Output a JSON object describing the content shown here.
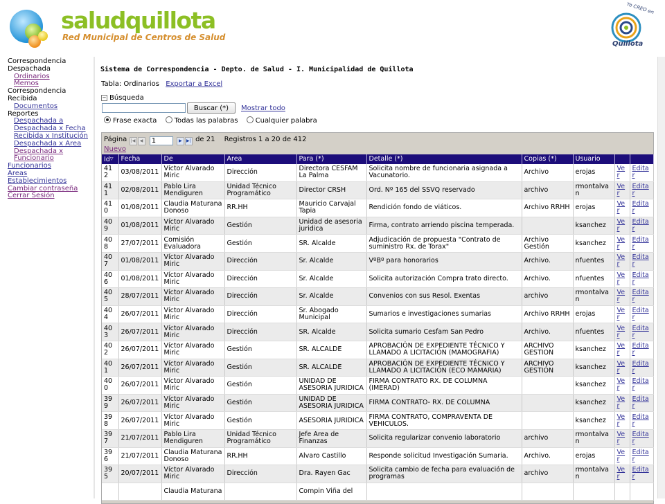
{
  "header": {
    "brand_name": "saludquillota",
    "brand_tagline": "Red Municipal de Centros de Salud",
    "seal_top": "Yo CREO en",
    "seal_word": "Quillota"
  },
  "sidebar": {
    "g1": "Correspondencia",
    "g1b": "Despachada",
    "ordinarios": "Ordinarios",
    "memos": "Memos",
    "g2": "Correspondencia",
    "g2b": "Recibida",
    "documentos": "Documentos",
    "g3": "Reportes",
    "r1a": "Despachada a",
    "r1b": "Despachada x Fecha",
    "r2": "Recibida x Institución",
    "r3": "Despachada x Area",
    "r4a": "Despachada x",
    "r4b": "Funcionario",
    "funcionarios": "Funcionarios",
    "areas": "Areas",
    "establecimientos": "Establecimientos",
    "cambiar": "Cambiar contraseña",
    "cerrar": "Cerrar Sesión"
  },
  "main": {
    "title": "Sistema de Correspondencia - Depto. de Salud - I. Municipalidad de Quillota",
    "tabla_label": "Tabla: Ordinarios",
    "exportar": "Exportar a Excel",
    "busqueda_label": "Búsqueda",
    "search_value": "",
    "buscar": "Buscar (*)",
    "mostrar_todo": "Mostrar todo",
    "radio_exacta": "Frase exacta",
    "radio_todas": "Todas las palabras",
    "radio_cualquier": "Cualquier palabra"
  },
  "pager": {
    "pagina": "Página",
    "page_value": "1",
    "de": "de 21",
    "registros": "Registros 1 a 20 de 412",
    "nuevo": "Nuevo"
  },
  "grid": {
    "columns": [
      "Id",
      "Fecha",
      "De",
      "Area",
      "Para (*)",
      "Detalle (*)",
      "Copias (*)",
      "Usuario",
      "",
      ""
    ],
    "ver": "Ver",
    "editar": "Editar",
    "rows": [
      [
        "412",
        "03/08/2011",
        "Víctor Alvarado Miric",
        "Dirección",
        "Directora CESFAM La Palma",
        "Solicita nombre de funcionaria asignada a Vacunatorio.",
        "Archivo",
        "erojas"
      ],
      [
        "411",
        "02/08/2011",
        "Pablo Lira Mendiguren",
        "Unidad Técnico Programático",
        "Director CRSH",
        "Ord. Nº 165 del SSVQ reservado",
        "archivo",
        "rmontalvan"
      ],
      [
        "410",
        "01/08/2011",
        "Claudia Maturana Donoso",
        "RR.HH",
        "Mauricio Carvajal Tapia",
        "Rendición fondo de viáticos.",
        "Archivo RRHH",
        "erojas"
      ],
      [
        "409",
        "01/08/2011",
        "Víctor Alvarado Miric",
        "Gestión",
        "Unidad de asesoria juridica",
        "Firma, contrato arriendo piscina temperada.",
        "",
        "ksanchez"
      ],
      [
        "408",
        "27/07/2011",
        "Comisión Evaluadora",
        "Gestión",
        "SR. Alcalde",
        "Adjudicación de propuesta \"Contrato de suministro Rx. de Torax\"",
        "Archivo Gestión",
        "ksanchez"
      ],
      [
        "407",
        "01/08/2011",
        "Víctor Alvarado Miric",
        "Dirección",
        "Sr. Alcalde",
        "VºBº para honorarios",
        "Archivo.",
        "nfuentes"
      ],
      [
        "406",
        "01/08/2011",
        "Víctor Alvarado Miric",
        "Dirección",
        "Sr. Alcalde",
        "Solicita autorización Compra trato directo.",
        "Archivo.",
        "nfuentes"
      ],
      [
        "405",
        "28/07/2011",
        "Víctor Alvarado Miric",
        "Dirección",
        "Sr. Alcalde",
        "Convenios con sus Resol. Exentas",
        "archivo",
        "rmontalvan"
      ],
      [
        "404",
        "26/07/2011",
        "Víctor Alvarado Miric",
        "Dirección",
        "Sr. Abogado Municipal",
        "Sumarios e investigaciones sumarias",
        "Archivo RRHH",
        "erojas"
      ],
      [
        "403",
        "26/07/2011",
        "Víctor Alvarado Miric",
        "Dirección",
        "SR. Alcalde",
        "Solicita sumario Cesfam San Pedro",
        "Archivo.",
        "nfuentes"
      ],
      [
        "402",
        "26/07/2011",
        "Víctor Alvarado Miric",
        "Gestión",
        "SR. ALCALDE",
        "APROBACIÓN DE EXPEDIENTE TÉCNICO Y LLAMADO A LICITACIÓN (MAMOGRAFIA)",
        "ARCHIVO GESTION",
        "ksanchez"
      ],
      [
        "401",
        "26/07/2011",
        "Víctor Alvarado Miric",
        "Gestión",
        "SR. ALCALDE",
        "APROBACIÓN DE EXPEDIENTE TÉCNICO Y LLAMADO A LICITACIÓN (ECO MAMARIA)",
        "ARCHIVO GESTIÓN",
        "ksanchez"
      ],
      [
        "400",
        "26/07/2011",
        "Víctor Alvarado Miric",
        "Gestión",
        "UNIDAD DE ASESORIA JURIDICA",
        "FIRMA CONTRATO RX. DE COLUMNA (IMERAD)",
        "",
        "ksanchez"
      ],
      [
        "399",
        "26/07/2011",
        "Víctor Alvarado Miric",
        "Gestión",
        "UNIDAD DE ASESORIA JURIDICA",
        "FIRMA CONTRATO- RX. DE COLUMNA",
        "",
        "ksanchez"
      ],
      [
        "398",
        "26/07/2011",
        "Víctor Alvarado Miric",
        "Gestión",
        "ASESORIA JURIDICA",
        "FIRMA CONTRATO, COMPRAVENTA DE VEHICULOS.",
        "",
        "ksanchez"
      ],
      [
        "397",
        "21/07/2011",
        "Pablo Lira Mendiguren",
        "Unidad Técnico Programático",
        "Jefe Area de Finanzas",
        "Solicita regularizar convenio laboratorio",
        "archivo",
        "rmontalvan"
      ],
      [
        "396",
        "21/07/2011",
        "Claudia Maturana Donoso",
        "RR.HH",
        "Alvaro Castillo",
        "Responde solicitud Investigación Sumaria.",
        "Archivo.",
        "erojas"
      ],
      [
        "395",
        "20/07/2011",
        "Víctor Alvarado Miric",
        "Dirección",
        "Dra. Rayen Gac",
        "Solicita cambio de fecha para evaluación de programas",
        "archivo",
        "rmontalvan"
      ],
      [
        "",
        "",
        "Claudia Maturana",
        "",
        "Compin Viña del",
        "",
        "",
        ""
      ]
    ]
  }
}
